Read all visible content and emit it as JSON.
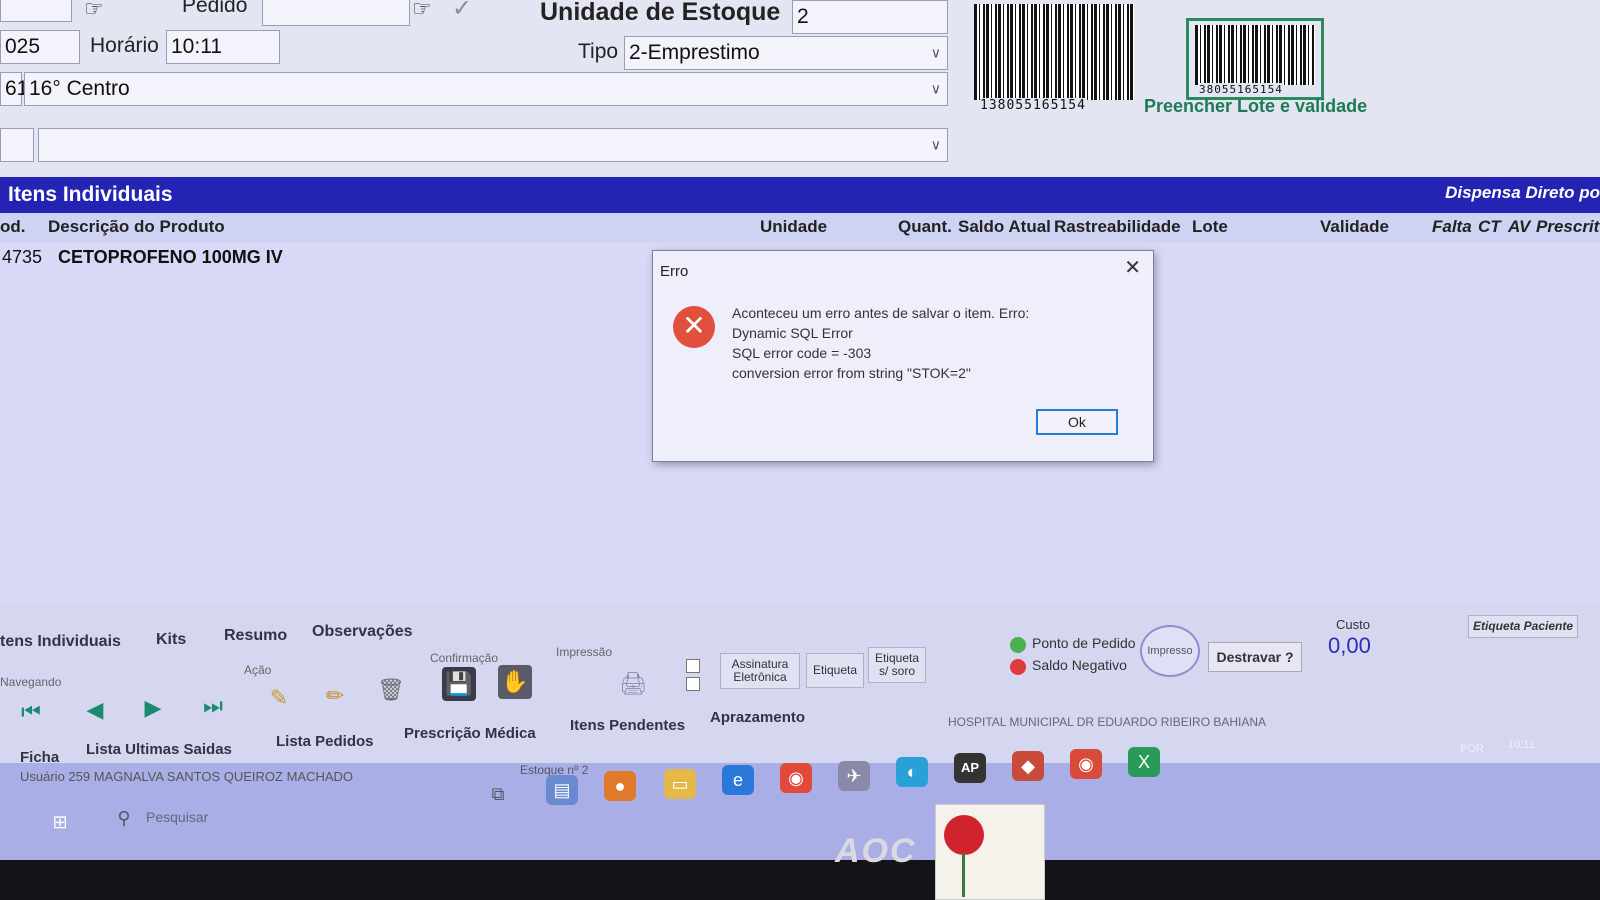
{
  "form": {
    "pedido_label": "Pedido",
    "unidade_estoque_label": "Unidade de Estoque",
    "unidade_estoque_value": "2",
    "date_partial": "025",
    "horario_label": "Horário",
    "horario_value": "10:11",
    "tipo_label": "Tipo",
    "tipo_value": "2-Emprestimo",
    "centro_code": "61",
    "centro_value": "16° Centro",
    "barcode_number": "138055165154",
    "barcode_small": "38055165154",
    "lote_link": "Preencher Lote e validade"
  },
  "items_section": {
    "title": "Itens Individuais",
    "right_title": "Dispensa Direto po",
    "columns": [
      "od.",
      "Descrição do Produto",
      "Unidade",
      "Quant.",
      "Saldo Atual",
      "Rastreabilidade",
      "Lote",
      "Validade",
      "Falta",
      "CT",
      "AV",
      "Prescrito"
    ],
    "rows": [
      {
        "code": "4735",
        "description": "CETOPROFENO 100MG IV"
      }
    ]
  },
  "dialog": {
    "title": "Erro",
    "line1": "Aconteceu um erro antes de salvar o item. Erro:",
    "line2": "Dynamic SQL Error",
    "line3": "SQL error code = -303",
    "line4": "conversion error from string \"STOK=2\"",
    "ok_label": "Ok"
  },
  "bottom": {
    "tabs": [
      "tens Individuais",
      "Kits",
      "Resumo",
      "Observações"
    ],
    "groups": {
      "nav": "Navegando",
      "acao": "Ação",
      "confirmacao": "Confirmação",
      "impressao": "Impressão"
    },
    "assinatura": "Assinatura Eletrônica",
    "etiqueta": "Etiqueta",
    "etiqueta_soro": "Etiqueta s/ soro",
    "ponto_pedido": "Ponto de Pedido",
    "saldo_negativo": "Saldo Negativo",
    "impresso": "Impresso",
    "destravar": "Destravar ?",
    "custo_label": "Custo",
    "custo_value": "0,00",
    "etiqueta_paciente": "Etiqueta Paciente",
    "links": [
      "Ficha",
      "Lista Ultimas Saidas",
      "Lista Pedidos",
      "Prescrição Médica",
      "Itens Pendentes",
      "Aprazamento"
    ],
    "hospital": "HOSPITAL MUNICIPAL DR EDUARDO RIBEIRO BAHIANA",
    "user": "Usuário 259 MAGNALVA SANTOS QUEIROZ MACHADO",
    "estoque": "Estoque nº 2"
  },
  "taskbar": {
    "search_placeholder": "Pesquisar",
    "ap_label": "AP",
    "lang": "POR",
    "time": "10:11"
  },
  "monitor": {
    "brand": "AOC"
  },
  "colors": {
    "header": "#2424b4",
    "accent": "#2a78d8",
    "error": "#e0503c",
    "link": "#1c7a54"
  }
}
